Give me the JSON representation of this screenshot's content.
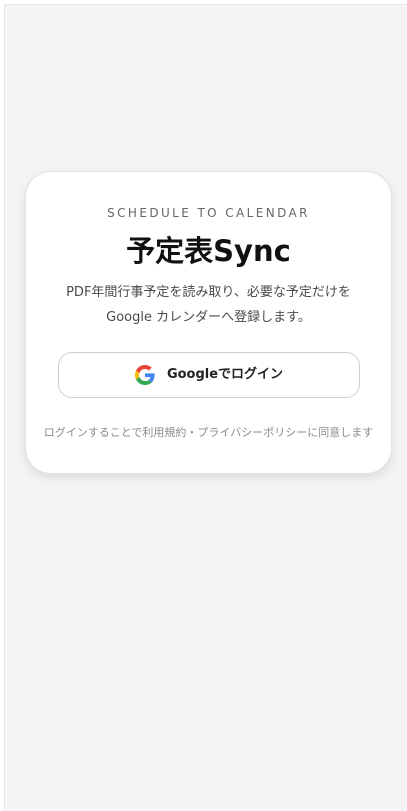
{
  "card": {
    "eyebrow": "SCHEDULE TO CALENDAR",
    "title": "予定表Sync",
    "description_line1": "PDF年間行事予定を読み取り、必要な予定だけを",
    "description_line2": "Google カレンダーへ登録します。",
    "login_button_label": "Googleでログイン",
    "login_button_icon": "google-g-icon",
    "footnote": "ログインすることで利用規約・プライバシーポリシーに同意します"
  },
  "colors": {
    "page_background": "#f4f4f4",
    "card_background": "#ffffff",
    "google_blue": "#4285F4",
    "google_red": "#EA4335",
    "google_yellow": "#FBBC05",
    "google_green": "#34A853"
  }
}
